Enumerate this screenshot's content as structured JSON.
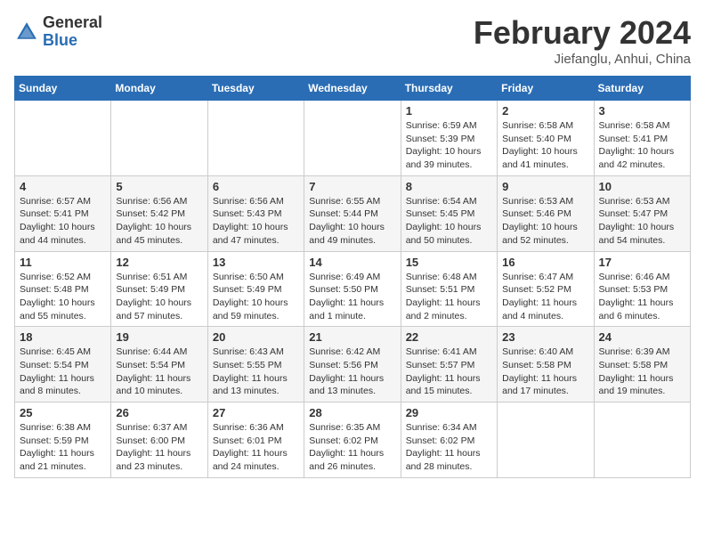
{
  "header": {
    "logo_general": "General",
    "logo_blue": "Blue",
    "month_title": "February 2024",
    "location": "Jiefanglu, Anhui, China"
  },
  "weekdays": [
    "Sunday",
    "Monday",
    "Tuesday",
    "Wednesday",
    "Thursday",
    "Friday",
    "Saturday"
  ],
  "weeks": [
    [
      {
        "day": "",
        "info": ""
      },
      {
        "day": "",
        "info": ""
      },
      {
        "day": "",
        "info": ""
      },
      {
        "day": "",
        "info": ""
      },
      {
        "day": "1",
        "info": "Sunrise: 6:59 AM\nSunset: 5:39 PM\nDaylight: 10 hours\nand 39 minutes."
      },
      {
        "day": "2",
        "info": "Sunrise: 6:58 AM\nSunset: 5:40 PM\nDaylight: 10 hours\nand 41 minutes."
      },
      {
        "day": "3",
        "info": "Sunrise: 6:58 AM\nSunset: 5:41 PM\nDaylight: 10 hours\nand 42 minutes."
      }
    ],
    [
      {
        "day": "4",
        "info": "Sunrise: 6:57 AM\nSunset: 5:41 PM\nDaylight: 10 hours\nand 44 minutes."
      },
      {
        "day": "5",
        "info": "Sunrise: 6:56 AM\nSunset: 5:42 PM\nDaylight: 10 hours\nand 45 minutes."
      },
      {
        "day": "6",
        "info": "Sunrise: 6:56 AM\nSunset: 5:43 PM\nDaylight: 10 hours\nand 47 minutes."
      },
      {
        "day": "7",
        "info": "Sunrise: 6:55 AM\nSunset: 5:44 PM\nDaylight: 10 hours\nand 49 minutes."
      },
      {
        "day": "8",
        "info": "Sunrise: 6:54 AM\nSunset: 5:45 PM\nDaylight: 10 hours\nand 50 minutes."
      },
      {
        "day": "9",
        "info": "Sunrise: 6:53 AM\nSunset: 5:46 PM\nDaylight: 10 hours\nand 52 minutes."
      },
      {
        "day": "10",
        "info": "Sunrise: 6:53 AM\nSunset: 5:47 PM\nDaylight: 10 hours\nand 54 minutes."
      }
    ],
    [
      {
        "day": "11",
        "info": "Sunrise: 6:52 AM\nSunset: 5:48 PM\nDaylight: 10 hours\nand 55 minutes."
      },
      {
        "day": "12",
        "info": "Sunrise: 6:51 AM\nSunset: 5:49 PM\nDaylight: 10 hours\nand 57 minutes."
      },
      {
        "day": "13",
        "info": "Sunrise: 6:50 AM\nSunset: 5:49 PM\nDaylight: 10 hours\nand 59 minutes."
      },
      {
        "day": "14",
        "info": "Sunrise: 6:49 AM\nSunset: 5:50 PM\nDaylight: 11 hours\nand 1 minute."
      },
      {
        "day": "15",
        "info": "Sunrise: 6:48 AM\nSunset: 5:51 PM\nDaylight: 11 hours\nand 2 minutes."
      },
      {
        "day": "16",
        "info": "Sunrise: 6:47 AM\nSunset: 5:52 PM\nDaylight: 11 hours\nand 4 minutes."
      },
      {
        "day": "17",
        "info": "Sunrise: 6:46 AM\nSunset: 5:53 PM\nDaylight: 11 hours\nand 6 minutes."
      }
    ],
    [
      {
        "day": "18",
        "info": "Sunrise: 6:45 AM\nSunset: 5:54 PM\nDaylight: 11 hours\nand 8 minutes."
      },
      {
        "day": "19",
        "info": "Sunrise: 6:44 AM\nSunset: 5:54 PM\nDaylight: 11 hours\nand 10 minutes."
      },
      {
        "day": "20",
        "info": "Sunrise: 6:43 AM\nSunset: 5:55 PM\nDaylight: 11 hours\nand 13 minutes."
      },
      {
        "day": "21",
        "info": "Sunrise: 6:42 AM\nSunset: 5:56 PM\nDaylight: 11 hours\nand 13 minutes."
      },
      {
        "day": "22",
        "info": "Sunrise: 6:41 AM\nSunset: 5:57 PM\nDaylight: 11 hours\nand 15 minutes."
      },
      {
        "day": "23",
        "info": "Sunrise: 6:40 AM\nSunset: 5:58 PM\nDaylight: 11 hours\nand 17 minutes."
      },
      {
        "day": "24",
        "info": "Sunrise: 6:39 AM\nSunset: 5:58 PM\nDaylight: 11 hours\nand 19 minutes."
      }
    ],
    [
      {
        "day": "25",
        "info": "Sunrise: 6:38 AM\nSunset: 5:59 PM\nDaylight: 11 hours\nand 21 minutes."
      },
      {
        "day": "26",
        "info": "Sunrise: 6:37 AM\nSunset: 6:00 PM\nDaylight: 11 hours\nand 23 minutes."
      },
      {
        "day": "27",
        "info": "Sunrise: 6:36 AM\nSunset: 6:01 PM\nDaylight: 11 hours\nand 24 minutes."
      },
      {
        "day": "28",
        "info": "Sunrise: 6:35 AM\nSunset: 6:02 PM\nDaylight: 11 hours\nand 26 minutes."
      },
      {
        "day": "29",
        "info": "Sunrise: 6:34 AM\nSunset: 6:02 PM\nDaylight: 11 hours\nand 28 minutes."
      },
      {
        "day": "",
        "info": ""
      },
      {
        "day": "",
        "info": ""
      }
    ]
  ]
}
